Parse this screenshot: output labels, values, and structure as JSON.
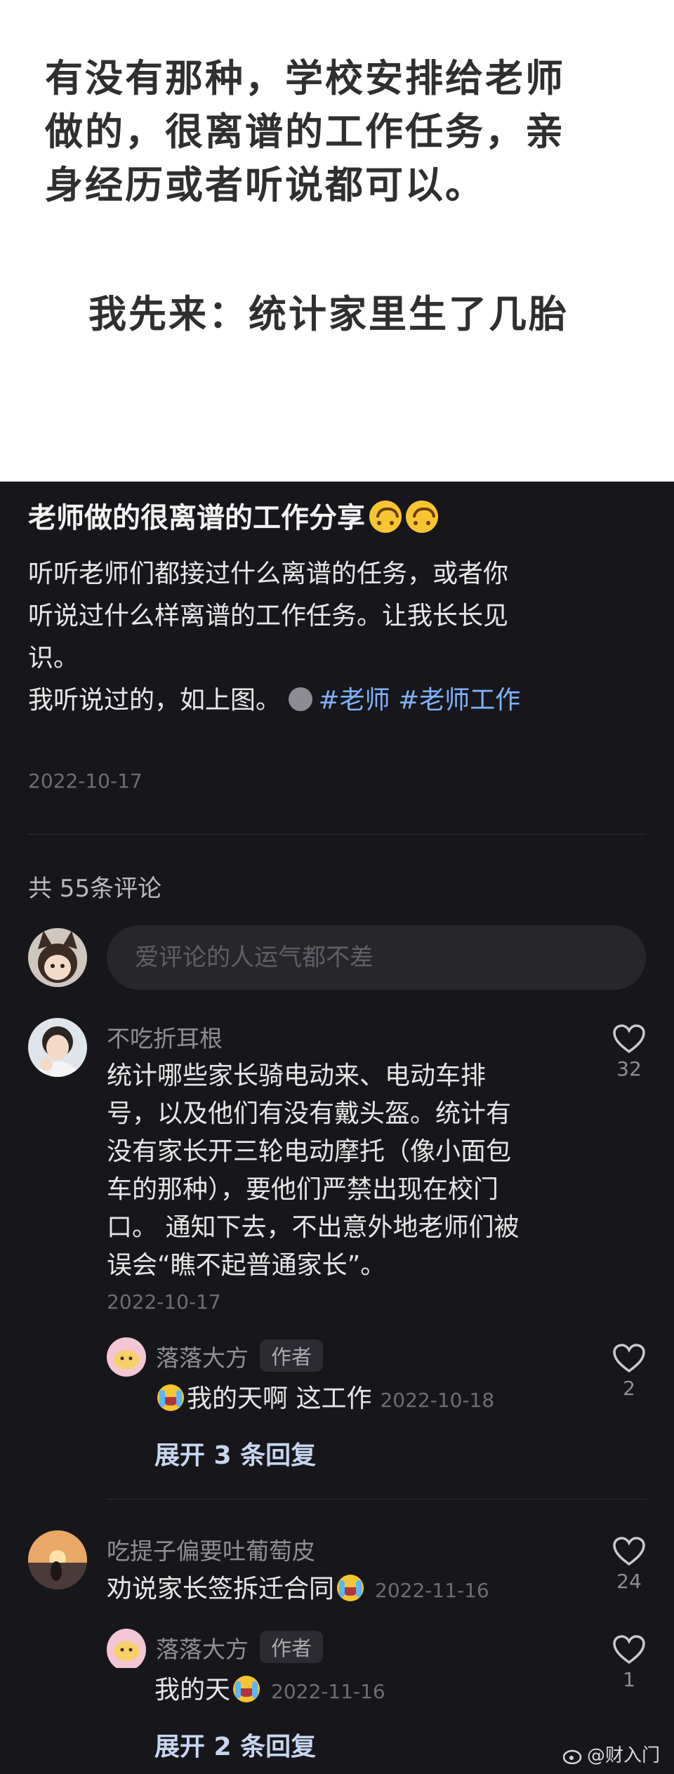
{
  "top_image": {
    "lines": [
      "有没有那种，学校安排给老师",
      "做的，很离谱的工作任务，亲",
      "身经历或者听说都可以。"
    ],
    "second_line": "我先来：统计家里生了几胎"
  },
  "post": {
    "title": "老师做的很离谱的工作分享",
    "body_lines": [
      "听听老师们都接过什么离谱的任务，或者你",
      "听说过什么样离谱的工作任务。让我长长见",
      "识。"
    ],
    "last_line_prefix": "我听说过的，如上图。",
    "tags": [
      "#老师",
      "#老师工作"
    ],
    "date": "2022-10-17"
  },
  "comments_header": {
    "count_text": "共 55条评论",
    "input_placeholder": "爱评论的人运气都不差"
  },
  "comments": [
    {
      "name": "不吃折耳根",
      "lines": [
        "统计哪些家长骑电动来、电动车排",
        "号，以及他们有没有戴头盔。统计有",
        "没有家长开三轮电动摩托（像小面包",
        "车的那种），要他们严禁出现在校门",
        "口。 通知下去，不出意外地老师们被",
        "误会“瞧不起普通家长”。"
      ],
      "date": "2022-10-17",
      "likes": "32",
      "reply": {
        "name": "落落大方",
        "badge": "作者",
        "text": "我的天啊 这工作",
        "date": "2022-10-18",
        "likes": "2"
      },
      "expand": "展开 3 条回复"
    },
    {
      "name": "吃提子偏要吐葡萄皮",
      "text": "劝说家长签拆迁合同",
      "date": "2022-11-16",
      "likes": "24",
      "reply": {
        "name": "落落大方",
        "badge": "作者",
        "text": "我的天",
        "date": "2022-11-16",
        "likes": "1"
      },
      "expand": "展开 2 条回复"
    }
  ],
  "watermark": "@财入门",
  "colors": {
    "dark_bg": "#17171b",
    "hashtag": "#7fb3ff",
    "expand": "#c8d6f0"
  },
  "icons": [
    "face-upside-down-emoji-icon",
    "heart-outline-icon",
    "loudly-crying-emoji-icon",
    "weibo-logo-icon"
  ]
}
